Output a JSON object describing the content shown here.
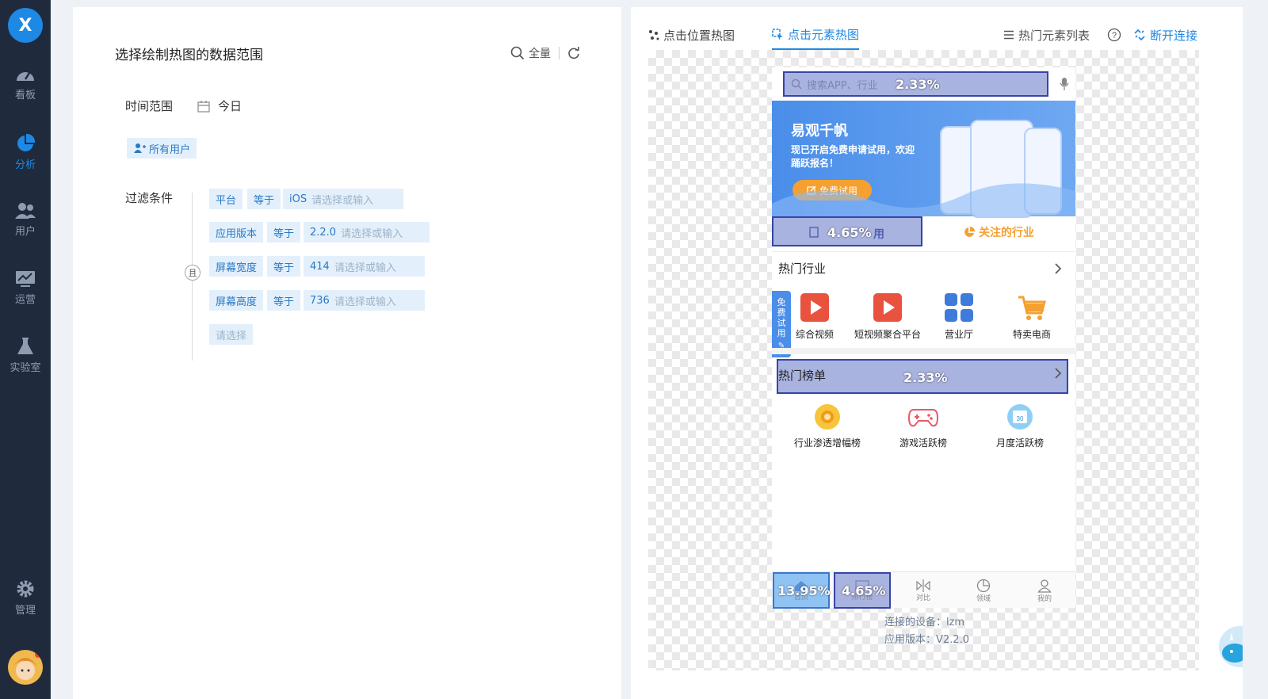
{
  "sidebar": {
    "logo": "X",
    "items": [
      {
        "label": "看板",
        "icon": "dashboard-icon"
      },
      {
        "label": "分析",
        "icon": "pie-chart-icon"
      },
      {
        "label": "用户",
        "icon": "users-icon"
      },
      {
        "label": "运营",
        "icon": "monitor-icon"
      },
      {
        "label": "实验室",
        "icon": "flask-icon"
      },
      {
        "label": "管理",
        "icon": "gear-icon"
      }
    ],
    "active": "分析"
  },
  "left": {
    "title": "选择绘制热图的数据范围",
    "full_label": "全量",
    "time_label": "时间范围",
    "time_value": "今日",
    "user_chip": "所有用户",
    "filter_label": "过滤条件",
    "and_label": "且",
    "filters": [
      {
        "field": "平台",
        "op": "等于",
        "value": "iOS",
        "placeholder": "请选择或输入"
      },
      {
        "field": "应用版本",
        "op": "等于",
        "value": "2.2.0",
        "placeholder": "请选择或输入"
      },
      {
        "field": "屏幕宽度",
        "op": "等于",
        "value": "414",
        "placeholder": "请选择或输入"
      },
      {
        "field": "屏幕高度",
        "op": "等于",
        "value": "736",
        "placeholder": "请选择或输入"
      }
    ],
    "empty_select": "请选择"
  },
  "right": {
    "tab_position": "点击位置热图",
    "tab_element": "点击元素热图",
    "hot_list": "热门元素列表",
    "disconnect": "断开连接",
    "device_line": "连接的设备：lzm",
    "version_line": "应用版本：V2.2.0"
  },
  "phone": {
    "search_placeholder": "搜索APP、行业",
    "search_pct": "2.33%",
    "banner_title": "易观千帆",
    "banner_sub": "现已开启免费申请试用，欢迎踊跃报名！",
    "banner_btn": "免费试用",
    "split_left_pct": "4.65%",
    "split_left_text": "用",
    "split_right": "关注的行业",
    "hot_industry": "热门行业",
    "side_tag": [
      "免",
      "费",
      "试",
      "用"
    ],
    "industries": [
      "综合视频",
      "短视频聚合平台",
      "营业厅",
      "特卖电商"
    ],
    "hot_rank": "热门榜单",
    "rank_pct": "2.33%",
    "ranks": [
      "行业渗透增幅榜",
      "游戏活跃榜",
      "月度活跃榜"
    ],
    "calendar_num": "30",
    "bottom_nav": [
      {
        "label": "首页",
        "pct": "13.95%"
      },
      {
        "label": "排行榜",
        "pct": "4.65%"
      },
      {
        "label": "对比",
        "pct": ""
      },
      {
        "label": "领域",
        "pct": ""
      },
      {
        "label": "我的",
        "pct": ""
      }
    ]
  },
  "colors": {
    "accent": "#1e88e5",
    "overlay": "#a9b3e0",
    "overlay_border": "#3744a8",
    "orange": "#f5a030"
  }
}
